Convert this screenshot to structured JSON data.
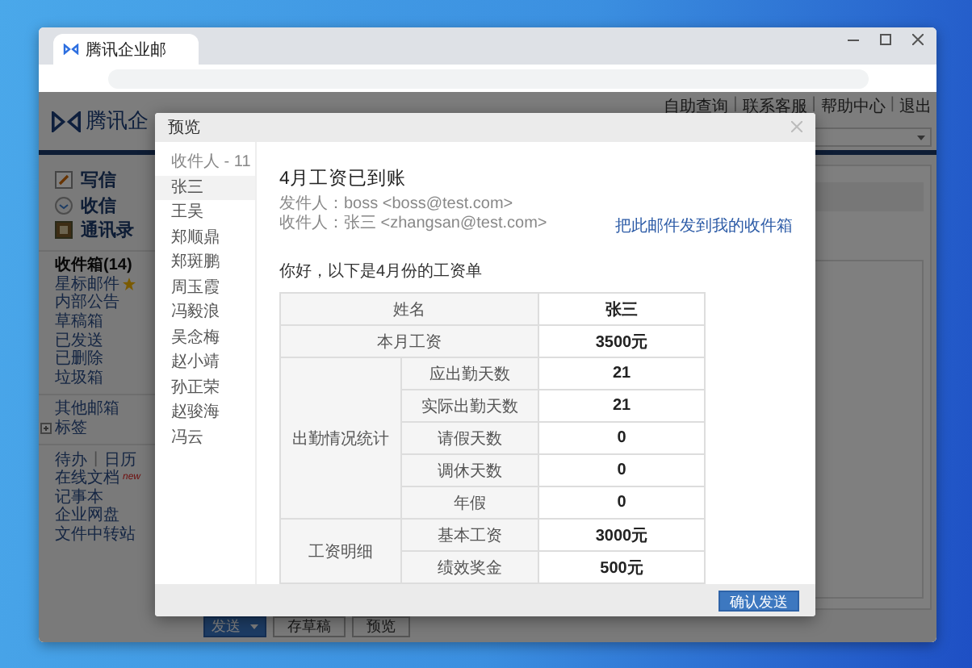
{
  "browser": {
    "tab_title": "腾讯企业邮"
  },
  "header": {
    "logo_text": "腾讯企",
    "links": [
      "自助查询",
      "联系客服",
      "帮助中心",
      "退出"
    ],
    "separator": "|"
  },
  "sidebar": {
    "actions": [
      {
        "label": "写信",
        "kind": "compose"
      },
      {
        "label": "收信",
        "kind": "inbox"
      },
      {
        "label": "通讯录",
        "kind": "contacts"
      }
    ],
    "folders": [
      {
        "label": "收件箱(14)",
        "bold": true,
        "starred": false
      },
      {
        "label": "星标邮件",
        "bold": false,
        "starred": true
      },
      {
        "label": "内部公告",
        "bold": false,
        "starred": false
      },
      {
        "label": "草稿箱",
        "bold": false,
        "starred": false
      },
      {
        "label": "已发送",
        "bold": false,
        "starred": false
      },
      {
        "label": "已删除",
        "bold": false,
        "starred": false
      },
      {
        "label": "垃圾箱",
        "bold": false,
        "starred": false
      }
    ],
    "other": [
      {
        "label": "其他邮箱",
        "expandable": false
      },
      {
        "label": "标签",
        "expandable": true
      }
    ],
    "tools": [
      {
        "label": "待办",
        "separator": "|",
        "label2": "日历"
      },
      {
        "label": "在线文档",
        "badge": "new"
      },
      {
        "label": "记事本"
      },
      {
        "label": "企业网盘"
      },
      {
        "label": "文件中转站"
      }
    ]
  },
  "compose_buttons": [
    {
      "label": "发送",
      "kind": "split"
    },
    {
      "label": "存草稿",
      "kind": "plain"
    },
    {
      "label": "预览",
      "kind": "plain"
    }
  ],
  "dialog": {
    "title": "预览",
    "recipients_heading": "收件人 - 11",
    "recipients": [
      {
        "name": "张三",
        "selected": true
      },
      {
        "name": "王吴",
        "selected": false
      },
      {
        "name": "郑顺鼎",
        "selected": false
      },
      {
        "name": "郑斑鹏",
        "selected": false
      },
      {
        "name": "周玉霞",
        "selected": false
      },
      {
        "name": "冯毅浪",
        "selected": false
      },
      {
        "name": "吴念梅",
        "selected": false
      },
      {
        "name": "赵小靖",
        "selected": false
      },
      {
        "name": "孙正荣",
        "selected": false
      },
      {
        "name": "赵骏海",
        "selected": false
      },
      {
        "name": "冯云",
        "selected": false
      }
    ],
    "subject": "4月工资已到账",
    "from": "发件人：boss <boss@test.com>",
    "to": "收件人：张三 <zhangsan@test.com>",
    "forward_link": "把此邮件发到我的收件箱",
    "greeting": "你好，以下是4月份的工资单",
    "table": {
      "rows": [
        {
          "label": "姓名",
          "value": "张三"
        },
        {
          "label": "本月工资",
          "value": "3500元"
        }
      ],
      "groups": [
        {
          "label": "出勤情况统计",
          "rows": [
            {
              "label": "应出勤天数",
              "value": "21"
            },
            {
              "label": "实际出勤天数",
              "value": "21"
            },
            {
              "label": "请假天数",
              "value": "0"
            },
            {
              "label": "调休天数",
              "value": "0"
            },
            {
              "label": "年假",
              "value": "0"
            }
          ]
        },
        {
          "label": "工资明细",
          "rows": [
            {
              "label": "基本工资",
              "value": "3000元"
            },
            {
              "label": "绩效奖金",
              "value": "500元"
            }
          ]
        }
      ]
    },
    "confirm_button": "确认发送"
  }
}
